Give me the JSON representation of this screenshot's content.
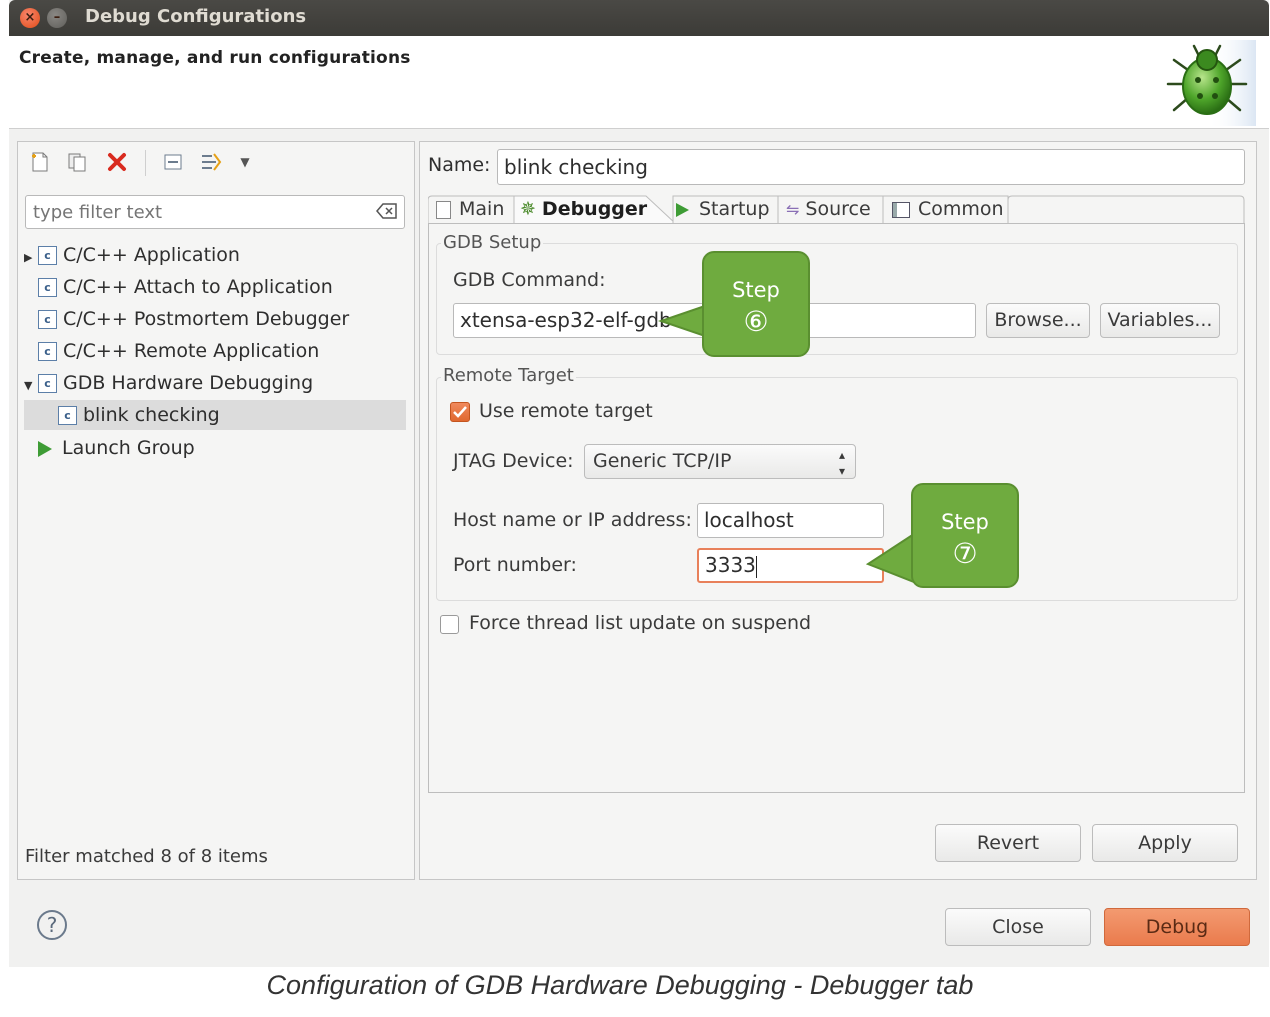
{
  "window": {
    "title": "Debug Configurations",
    "banner_text": "Create, manage, and run configurations"
  },
  "left": {
    "filter_placeholder": "type filter text",
    "tree": [
      {
        "label": "C/C++ Application",
        "expanded": false
      },
      {
        "label": "C/C++ Attach to Application"
      },
      {
        "label": "C/C++ Postmortem Debugger"
      },
      {
        "label": "C/C++ Remote Application"
      },
      {
        "label": "GDB Hardware Debugging",
        "expanded": true
      },
      {
        "label": "blink checking",
        "selected": true
      },
      {
        "label": "Launch Group"
      }
    ],
    "status": "Filter matched 8 of 8 items"
  },
  "right": {
    "name_label": "Name:",
    "name_value": "blink checking",
    "tabs": [
      "Main",
      "Debugger",
      "Startup",
      "Source",
      "Common"
    ],
    "active_tab": "Debugger",
    "gdb_setup": {
      "group_title": "GDB Setup",
      "command_label": "GDB Command:",
      "command_value": "xtensa-esp32-elf-gdb",
      "browse": "Browse...",
      "variables": "Variables..."
    },
    "remote_target": {
      "group_title": "Remote Target",
      "use_remote_label": "Use remote target",
      "use_remote_checked": true,
      "jtag_label": "JTAG Device:",
      "jtag_value": "Generic TCP/IP",
      "host_label": "Host name or IP address:",
      "host_value": "localhost",
      "port_label": "Port number:",
      "port_value": "3333"
    },
    "force_thread_label": "Force thread list update on suspend",
    "force_thread_checked": false,
    "revert": "Revert",
    "apply": "Apply"
  },
  "callouts": [
    {
      "label": "Step",
      "number": "⑥"
    },
    {
      "label": "Step",
      "number": "⑦"
    }
  ],
  "footer": {
    "help": "?",
    "close": "Close",
    "debug": "Debug"
  },
  "caption": "Configuration of GDB Hardware Debugging - Debugger tab",
  "colors": {
    "callout": "#6fab3f",
    "debug_button": "#f08a5d",
    "titlebar": "#3c3b37"
  }
}
